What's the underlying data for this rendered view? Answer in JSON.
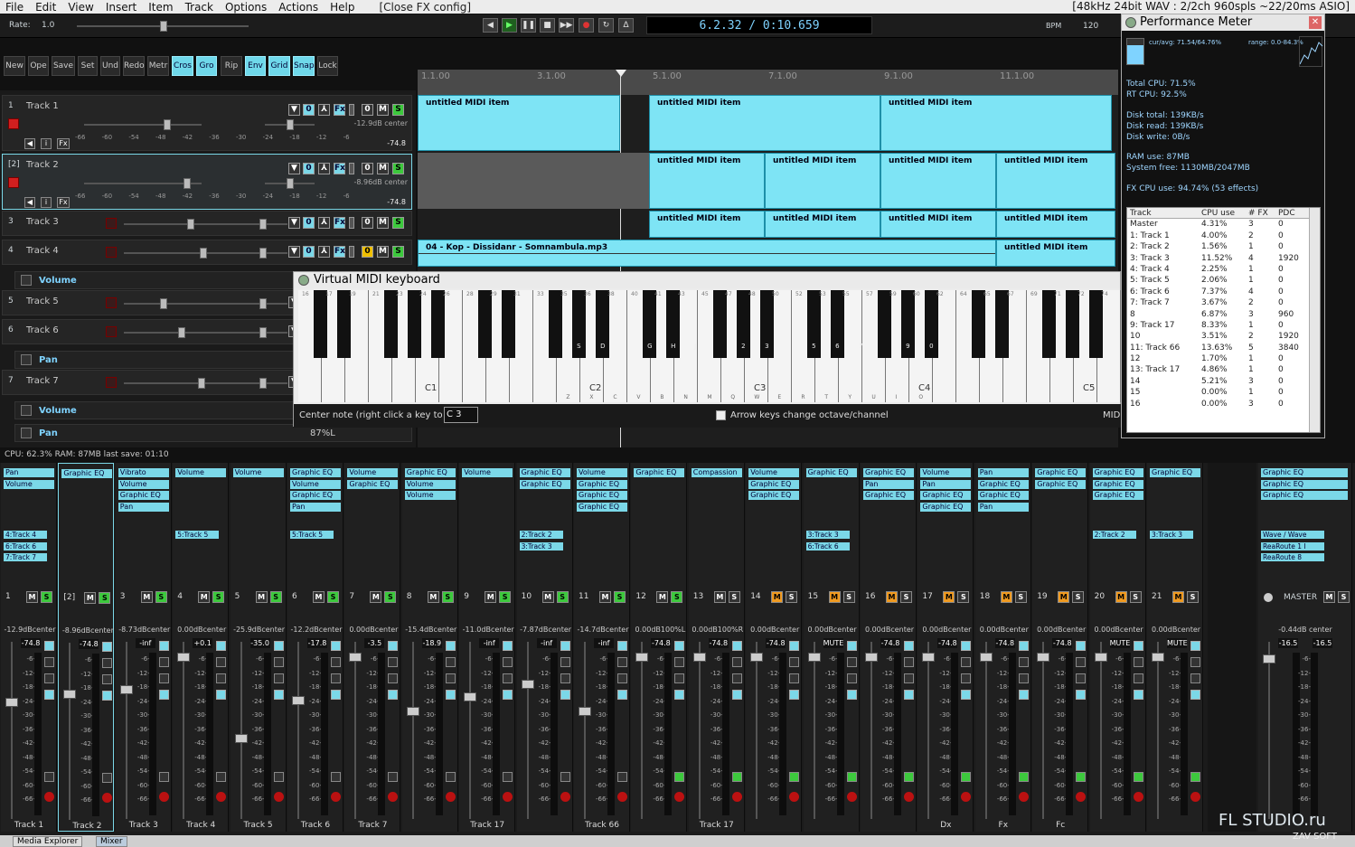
{
  "menubar": {
    "items": [
      "File",
      "Edit",
      "View",
      "Insert",
      "Item",
      "Track",
      "Options",
      "Actions",
      "Help"
    ],
    "note": "[Close FX config]",
    "info": "[48kHz 24bit WAV : 2/2ch 960spls ~22/20ms ASIO]"
  },
  "transport": {
    "rate_label": "Rate:",
    "rate_value": "1.0",
    "time": "6.2.32 / 0:10.659",
    "bpm_label": "BPM",
    "bpm_value": "120"
  },
  "toolbar": [
    {
      "label": "New",
      "on": false
    },
    {
      "label": "Ope",
      "on": false
    },
    {
      "label": "Save",
      "on": false
    },
    {
      "label": "Set",
      "on": false
    },
    {
      "label": "Und",
      "on": false
    },
    {
      "label": "Redo",
      "on": false
    },
    {
      "label": "Metr",
      "on": false
    },
    {
      "label": "Cros",
      "on": true
    },
    {
      "label": "Gro",
      "on": true
    },
    {
      "label": "Rip",
      "on": false
    },
    {
      "label": "Env",
      "on": true
    },
    {
      "label": "Grid",
      "on": true
    },
    {
      "label": "Snap",
      "on": true
    },
    {
      "label": "Lock",
      "on": false
    }
  ],
  "tracks": [
    {
      "num": "1",
      "name": "Track 1",
      "vol": "-12.9dB center",
      "scale": "-66 -60 -54 -48 -42 -36 -30 -24 -18 -12 -6",
      "peak": "-74.8"
    },
    {
      "num": "[2]",
      "name": "Track 2",
      "vol": "-8.96dB center",
      "scale": "-66 -60 -54 -48 -42 -36 -30 -24 -18 -12 -6",
      "peak": "-74.8"
    },
    {
      "num": "3",
      "name": "Track 3"
    },
    {
      "num": "4",
      "name": "Track 4"
    },
    {
      "num": "5",
      "name": "Track 5"
    },
    {
      "num": "6",
      "name": "Track 6"
    },
    {
      "num": "7",
      "name": "Track 7"
    }
  ],
  "envelopes": [
    "Volume",
    "Pan",
    "Volume",
    "Pan"
  ],
  "env_value": "87%L",
  "ruler": [
    "1.1.00",
    "3.1.00",
    "5.1.00",
    "7.1.00",
    "9.1.00",
    "11.1.00"
  ],
  "item_label": "untitled MIDI item",
  "audio_item": "04 - Kop - Dissidanr - Somnambula.mp3",
  "vkb": {
    "title": "Virtual MIDI keyboard",
    "center_label": "Center note (right click a key to set):",
    "center_value": "C 3",
    "arrow_label": "Arrow keys change octave/channel",
    "right_label": "MID",
    "octaves": [
      "C1",
      "C2",
      "C3",
      "C4",
      "C5"
    ],
    "top_nums": [
      "16",
      "17",
      "19",
      "21",
      "23",
      "24",
      "26",
      "28",
      "29",
      "31",
      "33",
      "35",
      "36",
      "38",
      "40",
      "41",
      "43",
      "45",
      "47",
      "48",
      "50",
      "52",
      "53",
      "55",
      "57",
      "59",
      "60",
      "62",
      "64",
      "65",
      "67",
      "69",
      "71",
      "72",
      "74"
    ],
    "black_letters": [
      "S",
      "D",
      "G",
      "H",
      "J",
      "2",
      "3",
      "5",
      "6",
      "7",
      "9",
      "0"
    ],
    "white_letters": [
      "Z",
      "X",
      "C",
      "V",
      "B",
      "N",
      "M",
      "Q",
      "W",
      "E",
      "R",
      "T",
      "Y",
      "U",
      "I",
      "O"
    ]
  },
  "perf": {
    "title": "Performance Meter",
    "curavg": "cur/avg: 71.54/64.76%",
    "range": "range: 0.0-84.3%",
    "total_cpu": "Total CPU: 71.5%",
    "rt_cpu": "RT CPU: 92.5%",
    "disk_total": "Disk total: 139KB/s",
    "disk_read": "Disk read: 139KB/s",
    "disk_write": "Disk write: 0B/s",
    "ram_use": "RAM use: 87MB",
    "sys_free": "System free: 1130MB/2047MB",
    "fx_cpu": "FX CPU use: 94.74% (53 effects)",
    "headers": [
      "Track",
      "CPU use",
      "# FX",
      "PDC"
    ],
    "rows": [
      [
        "Master",
        "4.31%",
        "3",
        "0"
      ],
      [
        "1: Track 1",
        "4.00%",
        "2",
        "0"
      ],
      [
        "2: Track 2",
        "1.56%",
        "1",
        "0"
      ],
      [
        "3: Track 3",
        "11.52%",
        "4",
        "1920"
      ],
      [
        "4: Track 4",
        "2.25%",
        "1",
        "0"
      ],
      [
        "5: Track 5",
        "2.06%",
        "1",
        "0"
      ],
      [
        "6: Track 6",
        "7.37%",
        "4",
        "0"
      ],
      [
        "7: Track 7",
        "3.67%",
        "2",
        "0"
      ],
      [
        "8",
        "6.87%",
        "3",
        "960"
      ],
      [
        "9: Track 17",
        "8.33%",
        "1",
        "0"
      ],
      [
        "10",
        "3.51%",
        "2",
        "1920"
      ],
      [
        "11: Track 66",
        "13.63%",
        "5",
        "3840"
      ],
      [
        "12",
        "1.70%",
        "1",
        "0"
      ],
      [
        "13: Track 17",
        "4.86%",
        "1",
        "0"
      ],
      [
        "14",
        "5.21%",
        "3",
        "0"
      ],
      [
        "15",
        "0.00%",
        "1",
        "0"
      ],
      [
        "16",
        "0.00%",
        "3",
        "0"
      ]
    ]
  },
  "status": "CPU: 62.3%  RAM: 87MB  last save: 01:10",
  "mixer": [
    {
      "num": "1",
      "fx": [
        "Pan",
        "Volume"
      ],
      "sends": [
        "4:Track 4",
        "6:Track 6",
        "7:Track 7"
      ],
      "vol": "-12.9dBcenter",
      "peak": "-74.8",
      "name": "Track 1",
      "mc": "g"
    },
    {
      "num": "[2]",
      "fx": [
        "Graphic EQ"
      ],
      "sends": [],
      "vol": "-8.96dBcenter",
      "peak": "-74.8",
      "name": "Track 2",
      "mc": "g"
    },
    {
      "num": "3",
      "fx": [
        "Vibrato",
        "Volume",
        "Graphic EQ",
        "Pan"
      ],
      "sends": [],
      "vol": "-8.73dBcenter",
      "peak": "-inf",
      "name": "Track 3",
      "mc": "g"
    },
    {
      "num": "4",
      "fx": [
        "Volume"
      ],
      "sends": [
        "5:Track 5"
      ],
      "vol": "0.00dBcenter",
      "peak": "+0.1",
      "name": "Track 4",
      "mc": "g"
    },
    {
      "num": "5",
      "fx": [
        "Volume"
      ],
      "sends": [],
      "vol": "-25.9dBcenter",
      "peak": "-35.0",
      "name": "Track 5",
      "mc": "g"
    },
    {
      "num": "6",
      "fx": [
        "Graphic EQ",
        "Volume",
        "Graphic EQ",
        "Pan"
      ],
      "sends": [
        "5:Track 5"
      ],
      "vol": "-12.2dBcenter",
      "peak": "-17.8",
      "name": "Track 6",
      "mc": "g"
    },
    {
      "num": "7",
      "fx": [
        "Volume",
        "Graphic EQ"
      ],
      "sends": [],
      "vol": "0.00dBcenter",
      "peak": "-3.5",
      "name": "Track 7",
      "mc": "g"
    },
    {
      "num": "8",
      "fx": [
        "Graphic EQ",
        "Volume",
        "Volume"
      ],
      "sends": [],
      "vol": "-15.4dBcenter",
      "peak": "-18.9",
      "name": "",
      "mc": "g"
    },
    {
      "num": "9",
      "fx": [
        "Volume"
      ],
      "sends": [],
      "vol": "-11.0dBcenter",
      "peak": "-inf",
      "name": "Track 17",
      "mc": "g"
    },
    {
      "num": "10",
      "fx": [
        "Graphic EQ",
        "Graphic EQ"
      ],
      "sends": [
        "2:Track 2",
        "3:Track 3"
      ],
      "vol": "-7.87dBcenter",
      "peak": "-inf",
      "name": "",
      "mc": "g"
    },
    {
      "num": "11",
      "fx": [
        "Volume",
        "Graphic EQ",
        "Graphic EQ",
        "Graphic EQ"
      ],
      "sends": [],
      "vol": "-14.7dBcenter",
      "peak": "-inf",
      "name": "Track 66",
      "mc": "g"
    },
    {
      "num": "12",
      "fx": [
        "Graphic EQ"
      ],
      "sends": [],
      "vol": "0.00dB100%L",
      "peak": "-74.8",
      "name": "",
      "mc": "g"
    },
    {
      "num": "13",
      "fx": [
        "Compassion"
      ],
      "sends": [],
      "vol": "0.00dB100%R",
      "peak": "-74.8",
      "name": "Track 17",
      "mc": "n"
    },
    {
      "num": "14",
      "fx": [
        "Volume",
        "Graphic EQ",
        "Graphic EQ"
      ],
      "sends": [],
      "vol": "0.00dBcenter",
      "peak": "-74.8",
      "name": "",
      "mc": "o"
    },
    {
      "num": "15",
      "fx": [
        "Graphic EQ"
      ],
      "sends": [
        "3:Track 3",
        "6:Track 6"
      ],
      "vol": "0.00dBcenter",
      "peak": "MUTE",
      "name": "",
      "mc": "o"
    },
    {
      "num": "16",
      "fx": [
        "Graphic EQ",
        "Pan",
        "Graphic EQ"
      ],
      "sends": [],
      "vol": "0.00dBcenter",
      "peak": "-74.8",
      "name": "",
      "mc": "o"
    },
    {
      "num": "17",
      "fx": [
        "Volume",
        "Pan",
        "Graphic EQ",
        "Graphic EQ"
      ],
      "sends": [],
      "vol": "0.00dBcenter",
      "peak": "-74.8",
      "name": "Dx",
      "mc": "o"
    },
    {
      "num": "18",
      "fx": [
        "Pan",
        "Graphic EQ",
        "Graphic EQ",
        "Pan"
      ],
      "sends": [],
      "vol": "0.00dBcenter",
      "peak": "-74.8",
      "name": "Fx",
      "mc": "o"
    },
    {
      "num": "19",
      "fx": [
        "Graphic EQ",
        "Graphic EQ"
      ],
      "sends": [],
      "vol": "0.00dBcenter",
      "peak": "-74.8",
      "name": "Fc",
      "mc": "o"
    },
    {
      "num": "20",
      "fx": [
        "Graphic EQ",
        "Graphic EQ",
        "Graphic EQ"
      ],
      "sends": [
        "2:Track 2"
      ],
      "vol": "0.00dBcenter",
      "peak": "MUTE",
      "name": "",
      "mc": "o"
    },
    {
      "num": "21",
      "fx": [
        "Graphic EQ"
      ],
      "sends": [
        "3:Track 3"
      ],
      "vol": "0.00dBcenter",
      "peak": "MUTE",
      "name": "",
      "mc": "o"
    }
  ],
  "master": {
    "label": "MASTER",
    "fx": [
      "Graphic EQ",
      "Graphic EQ",
      "Graphic EQ"
    ],
    "sends": [
      "Wave / Wave",
      "ReaRoute 1 I",
      "ReaRoute 8"
    ],
    "vol": "-0.44dB center",
    "peakL": "-16.5",
    "peakR": "-16.5"
  },
  "meter_scale": [
    "-6-",
    "-12-",
    "-18-",
    "-24-",
    "-30-",
    "-36-",
    "-42-",
    "-48-",
    "-54-",
    "-60-",
    "-66-"
  ],
  "bottom_tabs": [
    "Media Explorer",
    "Mixer"
  ],
  "watermark": "FL STUDIO.ru",
  "watermark2": "ZAV SOFT"
}
